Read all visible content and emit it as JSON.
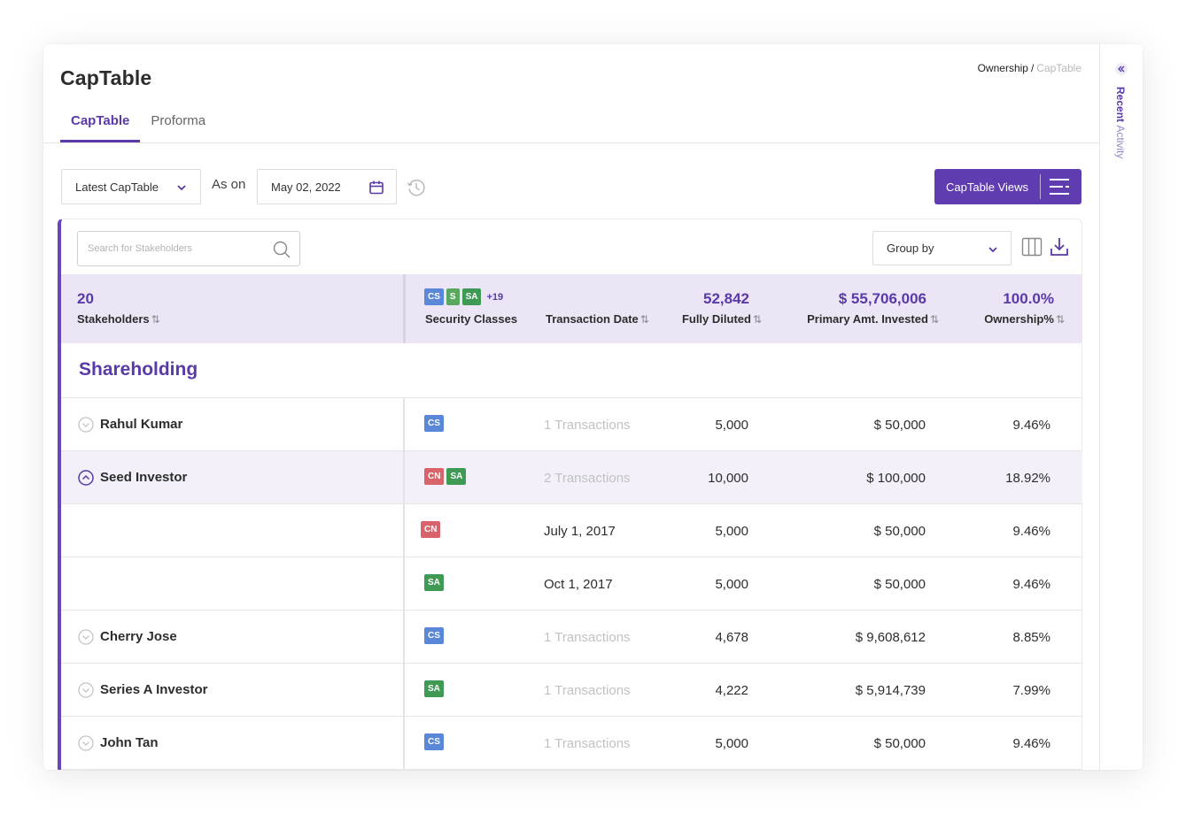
{
  "page": {
    "title": "CapTable"
  },
  "breadcrumb": {
    "parent": "Ownership",
    "separator": "/",
    "current": "CapTable"
  },
  "tabs": [
    {
      "label": "CapTable",
      "active": true
    },
    {
      "label": "Proforma",
      "active": false
    }
  ],
  "toolbar": {
    "captable_select": "Latest CapTable",
    "as_on_label": "As on",
    "date_value": "May 02, 2022",
    "views_button": "CapTable Views"
  },
  "table_tools": {
    "search_placeholder": "Search for Stakeholders",
    "group_by": "Group by"
  },
  "summary": {
    "stakeholders_count": "20",
    "stakeholders_label": "Stakeholders",
    "security_badges": [
      "CS",
      "S",
      "SA"
    ],
    "security_more": "+19",
    "security_label": "Security Classes",
    "transaction_date_label": "Transaction Date",
    "fully_diluted_value": "52,842",
    "fully_diluted_label": "Fully Diluted",
    "primary_amt_value": "$ 55,706,006",
    "primary_amt_label": "Primary Amt. Invested",
    "ownership_value": "100.0%",
    "ownership_label": "Ownership%",
    "sort_glyph": "⇅"
  },
  "section": {
    "title": "Shareholding"
  },
  "rows": [
    {
      "name": "Rahul Kumar",
      "badges": [
        "CS"
      ],
      "txn": "1 Transactions",
      "fd": "5,000",
      "amt": "$ 50,000",
      "own": "9.46%"
    },
    {
      "name": "Seed Investor",
      "badges": [
        "CN",
        "SA"
      ],
      "txn": "2 Transactions",
      "fd": "10,000",
      "amt": "$ 100,000",
      "own": "18.92%"
    },
    {
      "name": "",
      "badges": [
        "CN"
      ],
      "txn": "July 1, 2017",
      "fd": "5,000",
      "amt": "$ 50,000",
      "own": "9.46%"
    },
    {
      "name": "",
      "badges": [
        "SA"
      ],
      "txn": "Oct 1, 2017",
      "fd": "5,000",
      "amt": "$ 50,000",
      "own": "9.46%"
    },
    {
      "name": "Cherry Jose",
      "badges": [
        "CS"
      ],
      "txn": "1 Transactions",
      "fd": "4,678",
      "amt": "$ 9,608,612",
      "own": "8.85%"
    },
    {
      "name": "Series A Investor",
      "badges": [
        "SA"
      ],
      "txn": "1 Transactions",
      "fd": "4,222",
      "amt": "$ 5,914,739",
      "own": "7.99%"
    },
    {
      "name": "John Tan",
      "badges": [
        "CS"
      ],
      "txn": "1 Transactions",
      "fd": "5,000",
      "amt": "$ 50,000",
      "own": "9.46%"
    }
  ],
  "side_panel": {
    "title_bold": "Recent",
    "title_rest": "Activity"
  },
  "colors": {
    "accent": "#5f3cb0",
    "summary_bg": "#ebe5f6",
    "badge_cs": "#5b87d9",
    "badge_sa": "#3f9a55",
    "badge_s": "#5aa860",
    "badge_cn": "#d9636a"
  }
}
